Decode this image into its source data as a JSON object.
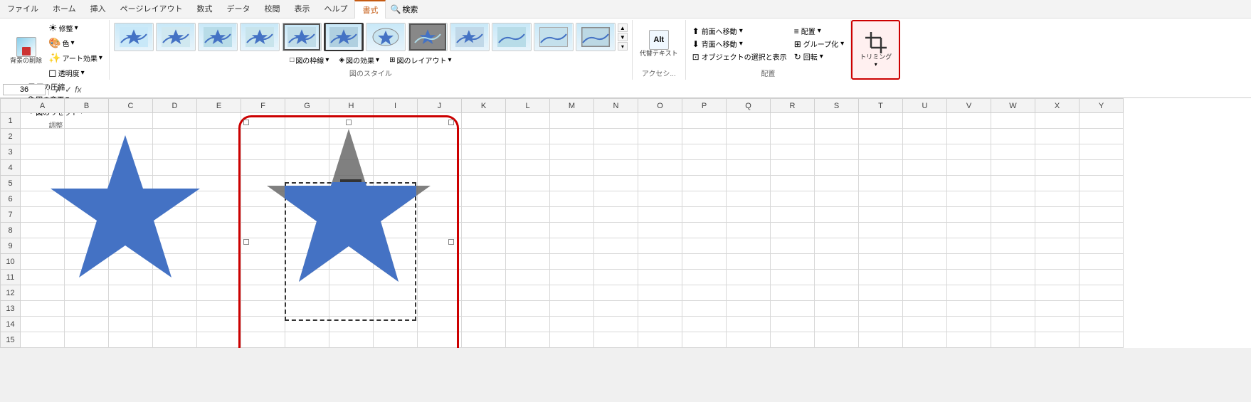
{
  "tabs": {
    "items": [
      "ファイル",
      "ホーム",
      "挿入",
      "ページレイアウト",
      "数式",
      "データ",
      "校閲",
      "表示",
      "ヘルプ",
      "書式"
    ]
  },
  "active_tab": "書式",
  "ribbon": {
    "groups": {
      "adjust": {
        "label": "調整",
        "buttons": [
          "背景の削除",
          "修整",
          "色",
          "アート効果",
          "透明度"
        ]
      },
      "compress_label": "図の圧縮",
      "change_label": "図の変更",
      "reset_label": "図のリセット",
      "style": {
        "label": "図のスタイル",
        "border_label": "図の枠線",
        "effect_label": "図の効果",
        "layout_label": "図のレイアウト"
      },
      "alt_text": "代替テキスト",
      "accessibility": "アクセシ...",
      "arrange": {
        "label": "配置",
        "front_label": "前面へ移動",
        "back_label": "背面へ移動",
        "select_label": "オブジェクトの選択と表示",
        "align_label": "配置",
        "group_label": "グループ化",
        "rotate_label": "回転"
      },
      "crop": {
        "label": "トリミング"
      }
    }
  },
  "formula_bar": {
    "name_box": "36",
    "fx_symbol": "fx"
  },
  "columns": [
    "A",
    "B",
    "C",
    "D",
    "E",
    "F",
    "G",
    "H",
    "I",
    "J",
    "K",
    "L",
    "M",
    "N",
    "O",
    "P",
    "Q",
    "R",
    "S",
    "T",
    "U",
    "V",
    "W",
    "X",
    "Y"
  ],
  "rows": [
    1,
    2,
    3,
    4,
    5,
    6,
    7,
    8,
    9,
    10,
    11,
    12,
    13,
    14,
    15
  ],
  "star_colors": {
    "blue": "#4472C4",
    "dark_gray": "#404040"
  },
  "crop_border_color": "#CC0000",
  "selection_border_color": "#CC0000"
}
